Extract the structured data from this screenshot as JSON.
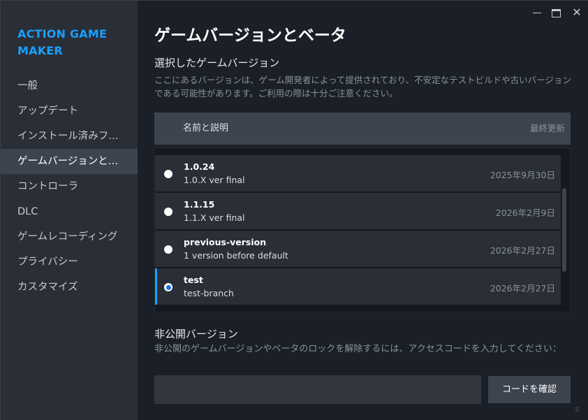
{
  "sidebar": {
    "app_title": "ACTION GAME MAKER",
    "items": [
      {
        "label": "一般"
      },
      {
        "label": "アップデート"
      },
      {
        "label": "インストール済みファイル"
      },
      {
        "label": "ゲームバージョンとベータ"
      },
      {
        "label": "コントローラ"
      },
      {
        "label": "DLC"
      },
      {
        "label": "ゲームレコーディング"
      },
      {
        "label": "プライバシー"
      },
      {
        "label": "カスタマイズ"
      }
    ],
    "active_index": 3
  },
  "main": {
    "title": "ゲームバージョンとベータ",
    "section_title": "選択したゲームバージョン",
    "description": "ここにあるバージョンは、ゲーム開発者によって提供されており、不安定なテストビルドや古いバージョンである可能性があります。ご利用の際は十分ご注意ください。",
    "table": {
      "header_name": "名前と説明",
      "header_date": "最終更新",
      "rows": [
        {
          "name": "1.0.24",
          "desc": "1.0.X ver final",
          "date": "2025年9月30日",
          "selected": false
        },
        {
          "name": "1.1.15",
          "desc": "1.1.X ver final",
          "date": "2026年2月9日",
          "selected": false
        },
        {
          "name": "previous-version",
          "desc": "1 version before default",
          "date": "2026年2月27日",
          "selected": false
        },
        {
          "name": "test",
          "desc": "test-branch",
          "date": "2026年2月27日",
          "selected": true
        }
      ]
    },
    "private": {
      "title": "非公開バージョン",
      "description": "非公開のゲームバージョンやベータのロックを解除するには、アクセスコードを入力してください：",
      "input_value": "",
      "input_placeholder": "",
      "button_label": "コードを確認"
    }
  },
  "window_controls": {
    "minimize_icon": "minimize-icon",
    "maximize_icon": "maximize-icon",
    "close_icon": "close-icon",
    "close_glyph": "✕"
  },
  "colors": {
    "accent": "#1a9fff",
    "sidebar_bg": "#2a2e36",
    "main_bg": "#1b2028",
    "header_bg": "#3d4450"
  }
}
